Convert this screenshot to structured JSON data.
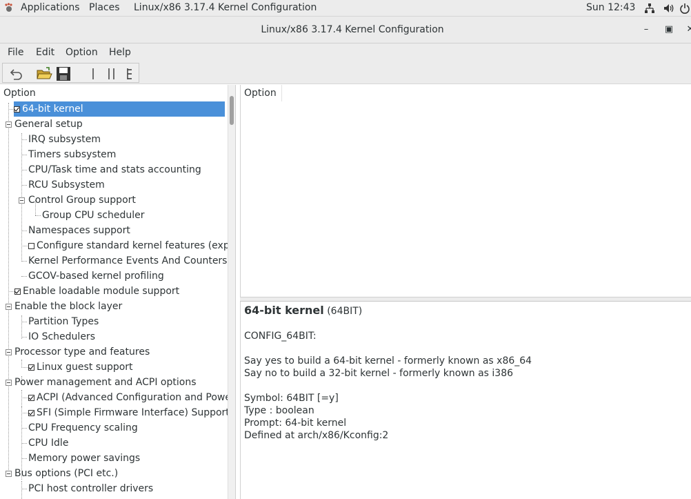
{
  "topbar": {
    "applications": "Applications",
    "places": "Places",
    "active_window": "Linux/x86 3.17.4 Kernel Configuration",
    "clock": "Sun 12:43"
  },
  "window": {
    "title": "Linux/x86 3.17.4 Kernel Configuration",
    "minimize": "–",
    "maximize": "▣",
    "close": "✕"
  },
  "menubar": {
    "file": "File",
    "edit": "Edit",
    "option": "Option",
    "help": "Help"
  },
  "tree": {
    "header": "Option",
    "rows": [
      {
        "label": "64-bit kernel",
        "checked": true
      },
      {
        "label": "General setup"
      },
      {
        "label": "IRQ subsystem"
      },
      {
        "label": "Timers subsystem"
      },
      {
        "label": "CPU/Task time and stats accounting"
      },
      {
        "label": "RCU Subsystem"
      },
      {
        "label": "Control Group support"
      },
      {
        "label": "Group CPU scheduler"
      },
      {
        "label": "Namespaces support"
      },
      {
        "label": "Configure standard kernel features (expert",
        "checked": false
      },
      {
        "label": "Kernel Performance Events And Counters"
      },
      {
        "label": "GCOV-based kernel profiling"
      },
      {
        "label": "Enable loadable module support",
        "checked": true
      },
      {
        "label": "Enable the block layer"
      },
      {
        "label": "Partition Types"
      },
      {
        "label": "IO Schedulers"
      },
      {
        "label": "Processor type and features"
      },
      {
        "label": "Linux guest support",
        "checked": true
      },
      {
        "label": "Power management and ACPI options"
      },
      {
        "label": "ACPI (Advanced Configuration and Power In",
        "checked": true
      },
      {
        "label": "SFI (Simple Firmware Interface) Support",
        "checked": true
      },
      {
        "label": "CPU Frequency scaling"
      },
      {
        "label": "CPU Idle"
      },
      {
        "label": "Memory power savings"
      },
      {
        "label": "Bus options (PCI etc.)"
      },
      {
        "label": "PCI host controller drivers"
      }
    ]
  },
  "right": {
    "header": "Option"
  },
  "help": {
    "title": "64-bit kernel",
    "symbol_paren": "(64BIT)",
    "config": "CONFIG_64BIT:",
    "desc1": "Say yes to build a 64-bit kernel - formerly known as x86_64",
    "desc2": "Say no to build a 32-bit kernel - formerly known as i386",
    "symbol": "Symbol: 64BIT [=y]",
    "type": "Type : boolean",
    "prompt": "Prompt: 64-bit kernel",
    "defined": "Defined at arch/x86/Kconfig:2"
  }
}
